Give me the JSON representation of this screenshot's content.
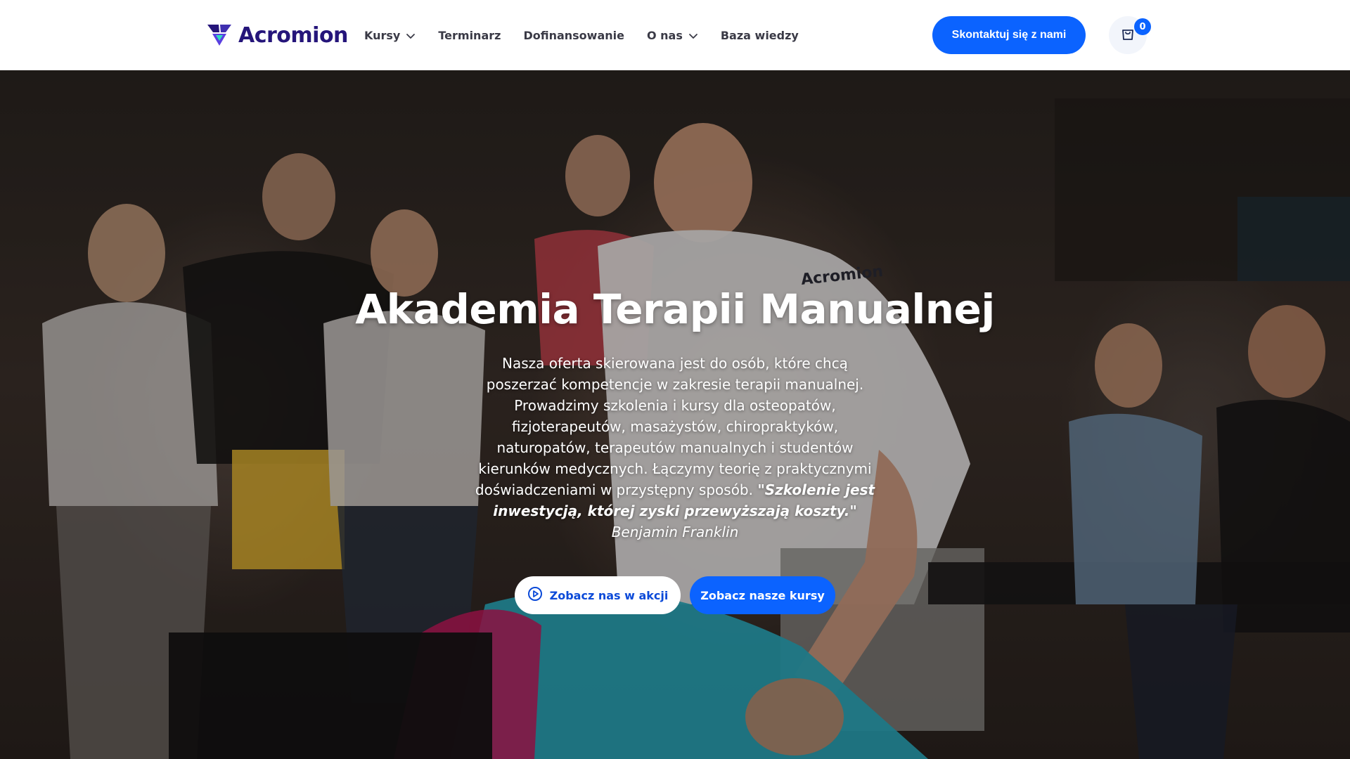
{
  "brand": {
    "name": "Acromion",
    "logo_icon": "acromion-v-logo-icon",
    "color": "#25157a"
  },
  "nav": {
    "items": [
      {
        "label": "Kursy",
        "has_dropdown": true
      },
      {
        "label": "Terminarz",
        "has_dropdown": false
      },
      {
        "label": "Dofinansowanie",
        "has_dropdown": false
      },
      {
        "label": "O nas",
        "has_dropdown": true
      },
      {
        "label": "Baza wiedzy",
        "has_dropdown": false
      }
    ]
  },
  "header": {
    "contact_label": "Skontaktuj się z nami",
    "cart_icon": "shopping-bag-icon",
    "cart_count": "0"
  },
  "hero": {
    "title": "Akademia Terapii Manualnej",
    "description": "Nasza oferta skierowana jest do osób, które chcą poszerzać kompetencje w zakresie terapii manualnej. Prowadzimy szkolenia i kursy dla osteopatów, fizjoterapeutów, masażystów, chiropraktyków, naturopatów, terapeutów manualnych i studentów kierunków medycznych. Łączymy teorię z praktycznymi doświadczeniami w przystępny sposób.",
    "quote": "\"Szkolenie jest inwestycją, której zyski przewyższają koszty.\"",
    "quote_author": "Benjamin Franklin",
    "watch_label": "Zobacz nas w akcji",
    "watch_icon": "play-circle-icon",
    "courses_label": "Zobacz nasze kursy",
    "shirt_logo": "Acromion"
  },
  "colors": {
    "accent": "#0b63ff",
    "nav_text": "#3a3a46",
    "hero_text": "#ffffff"
  }
}
